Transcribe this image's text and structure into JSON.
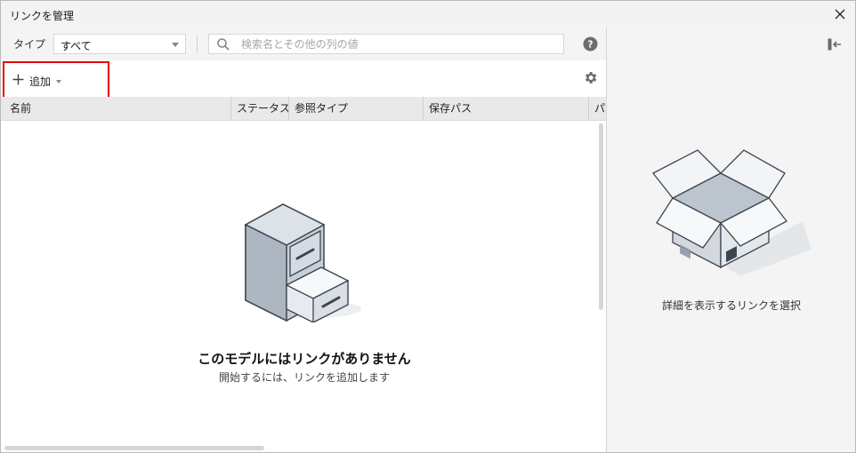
{
  "window": {
    "title": "リンクを管理",
    "close_icon": "close-icon"
  },
  "filter": {
    "type_label": "タイプ",
    "type_value": "すべて",
    "search_placeholder": "検索名とその他の列の値",
    "search_value": "",
    "help_icon": "help-icon"
  },
  "toolbar": {
    "add_label": "追加",
    "settings_icon": "gear-icon"
  },
  "table": {
    "columns": [
      "名前",
      "ステータス",
      "参照タイプ",
      "保存パス",
      "パ"
    ]
  },
  "empty_state": {
    "title": "このモデルにはリンクがありません",
    "subtitle": "開始するには、リンクを追加します"
  },
  "detail_panel": {
    "message": "詳細を表示するリンクを選択",
    "collapse_icon": "panel-collapse-icon"
  },
  "colors": {
    "highlight_border": "#e30000",
    "header_bg": "#e9e9e9",
    "panel_bg": "#f4f4f4"
  }
}
